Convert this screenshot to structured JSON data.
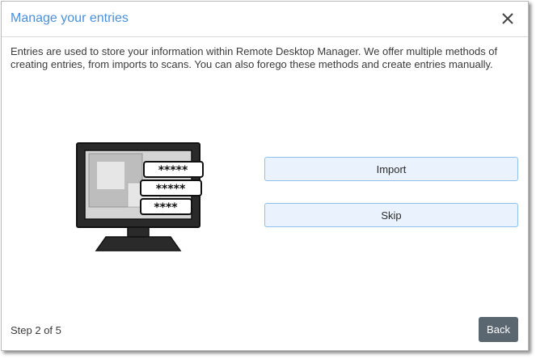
{
  "dialog": {
    "title": "Manage your entries",
    "description": "Entries are used to store your information within Remote Desktop Manager. We offer multiple methods of creating entries, from imports to scans. You can also forego these methods and create entries manually.",
    "close_icon": "close-icon"
  },
  "illustration": {
    "icon": "monitor-passwords-icon",
    "password_fields": [
      "*****",
      "*****",
      "****"
    ]
  },
  "actions": {
    "import_label": "Import",
    "skip_label": "Skip"
  },
  "footer": {
    "step_text": "Step 2 of 5",
    "back_label": "Back"
  },
  "colors": {
    "title": "#4a90d9",
    "button_bg": "#eaf3fd",
    "button_border": "#8fbfea",
    "back_bg": "#5a6670"
  }
}
